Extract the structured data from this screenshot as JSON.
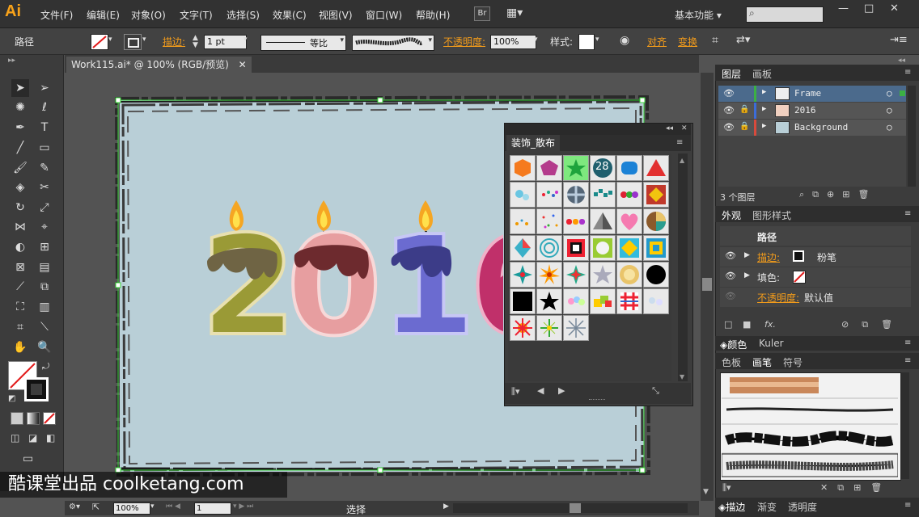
{
  "app": {
    "logo": "Ai"
  },
  "menu": [
    "文件(F)",
    "编辑(E)",
    "对象(O)",
    "文字(T)",
    "选择(S)",
    "效果(C)",
    "视图(V)",
    "窗口(W)",
    "帮助(H)"
  ],
  "menu_bar": {
    "br_label": "Br",
    "workspace": "基本功能",
    "window_controls": [
      "—",
      "□",
      "✕"
    ]
  },
  "control_bar": {
    "object_type": "路径",
    "stroke_label": "描边:",
    "stroke_weight": "1 pt",
    "profile_label": "等比",
    "opacity_label": "不透明度:",
    "opacity_value": "100%",
    "style_label": "样式:",
    "align_label": "对齐",
    "transform_label": "变换"
  },
  "document": {
    "tab_title": "Work115.ai* @ 100% (RGB/预览)",
    "close": "✕"
  },
  "canvas": {
    "numbers": [
      "2",
      "0",
      "1",
      "6"
    ]
  },
  "status_bar": {
    "zoom": "100%",
    "page": "1",
    "status": "选择"
  },
  "symbols_panel": {
    "title": "装饰_散布",
    "badge": "28"
  },
  "layers_panel": {
    "tabs": [
      "图层",
      "画板"
    ],
    "layers": [
      {
        "name": "Frame",
        "color": "#3cb043"
      },
      {
        "name": "2016",
        "color": "#3c6cd8"
      },
      {
        "name": "Background",
        "color": "#d84a3c"
      }
    ],
    "footer": "3 个图层"
  },
  "appearance_panel": {
    "tabs": [
      "外观",
      "图形样式"
    ],
    "header": "路径",
    "rows": [
      {
        "label": "描边:",
        "value": "粉笔"
      },
      {
        "label": "填色:",
        "value": ""
      },
      {
        "label": "不透明度:",
        "value": "默认值"
      }
    ],
    "fx": "fx."
  },
  "color_tabs": [
    "颜色",
    "Kuler"
  ],
  "brush_tabs": [
    "色板",
    "画笔",
    "符号"
  ],
  "bottom_tabs": [
    "描边",
    "渐变",
    "透明度"
  ],
  "watermark": "酷课堂出品 coolketang.com"
}
